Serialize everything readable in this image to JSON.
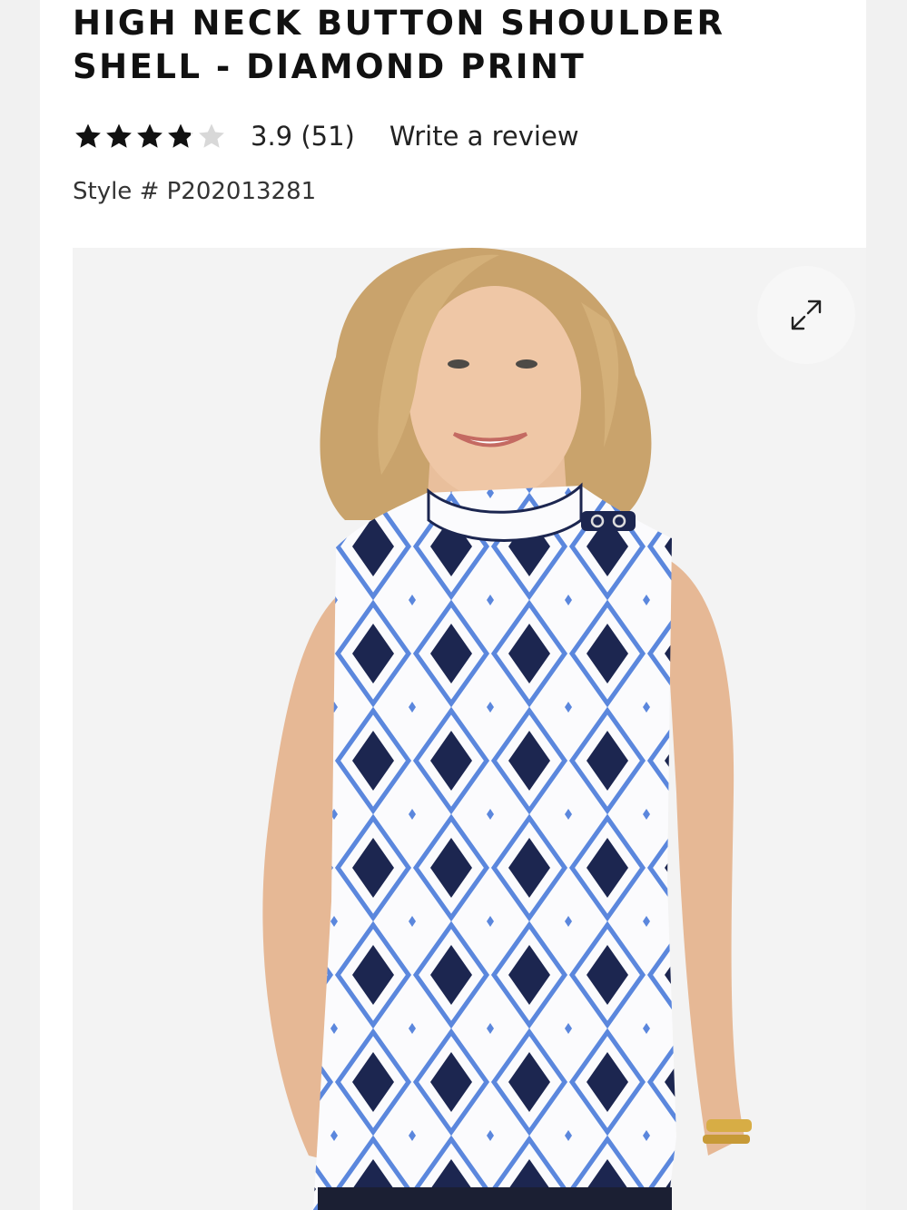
{
  "product": {
    "title_line1": "HIGH NECK BUTTON SHOULDER",
    "title_line2": "SHELL - DIAMOND PRINT",
    "rating": {
      "stars_filled": 3.9,
      "stars_total": 5,
      "value": "3.9",
      "count": "(51)",
      "write_review_label": "Write a review"
    },
    "style_label": "Style #",
    "style_number": "P202013281"
  },
  "image": {
    "expand_icon": "expand-arrows-icon",
    "alt": "Model wearing high neck button shoulder shell in navy and blue diamond print"
  },
  "colors": {
    "navy": "#1c2650",
    "blue": "#5b87dd",
    "text": "#111111",
    "star_empty": "#d8d8d8"
  }
}
